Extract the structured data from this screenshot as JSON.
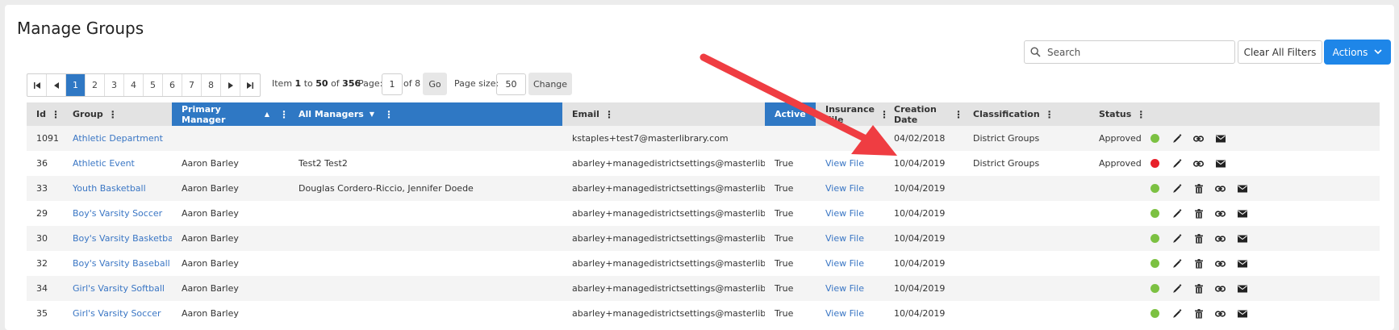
{
  "page": {
    "title": "Manage Groups"
  },
  "toolbar": {
    "search_placeholder": "Search",
    "clear_filters_label": "Clear All Filters",
    "actions_label": "Actions"
  },
  "pager": {
    "pages": [
      "1",
      "2",
      "3",
      "4",
      "5",
      "6",
      "7",
      "8"
    ],
    "active_page": "1",
    "item_prefix": "Item",
    "item_from": "1",
    "item_to_word": "to",
    "item_to": "50",
    "item_of_word": "of",
    "item_total": "356",
    "page_label": "Page:",
    "page_value": "1",
    "of_pages": "of 8",
    "go_label": "Go",
    "page_size_label": "Page size:",
    "page_size_value": "50",
    "change_label": "Change"
  },
  "columns": [
    {
      "key": "id",
      "label": "Id",
      "sort": "",
      "selected": false
    },
    {
      "key": "group",
      "label": "Group",
      "sort": "",
      "selected": false
    },
    {
      "key": "primary_manager",
      "label": "Primary Manager",
      "sort": "▲",
      "selected": true
    },
    {
      "key": "all_managers",
      "label": "All Managers",
      "sort": "▼",
      "selected": true
    },
    {
      "key": "email",
      "label": "Email",
      "sort": "",
      "selected": false
    },
    {
      "key": "active",
      "label": "Active",
      "sort": "",
      "selected": true
    },
    {
      "key": "insurance_file",
      "label": "Insurance File",
      "sort": "",
      "selected": false
    },
    {
      "key": "creation_date",
      "label": "Creation Date",
      "sort": "",
      "selected": false
    },
    {
      "key": "classification",
      "label": "Classification",
      "sort": "",
      "selected": false
    },
    {
      "key": "status",
      "label": "Status",
      "sort": "",
      "selected": false
    }
  ],
  "rows": [
    {
      "id": "1091",
      "group": "Athletic Department",
      "primary_manager": "",
      "all_managers": "",
      "email": "kstaples+test7@masterlibrary.com",
      "active": "",
      "insurance_file": "",
      "creation_date": "04/02/2018",
      "classification": "District Groups",
      "status": "Approved",
      "status_color": "#7cc142",
      "has_delete": false
    },
    {
      "id": "36",
      "group": "Athletic Event",
      "primary_manager": "Aaron Barley",
      "all_managers": "Test2 Test2",
      "email": "abarley+managedistrictsettings@masterlibrary.com",
      "active": "True",
      "insurance_file": "View File",
      "creation_date": "10/04/2019",
      "classification": "District Groups",
      "status": "Approved",
      "status_color": "#e8202a",
      "has_delete": false
    },
    {
      "id": "33",
      "group": "Youth Basketball",
      "primary_manager": "Aaron Barley",
      "all_managers": "Douglas Cordero-Riccio, Jennifer Doede",
      "email": "abarley+managedistrictsettings@masterlibrary.com",
      "active": "True",
      "insurance_file": "View File",
      "creation_date": "10/04/2019",
      "classification": "",
      "status": "",
      "status_color": "#7cc142",
      "has_delete": true
    },
    {
      "id": "29",
      "group": "Boy's Varsity Soccer",
      "primary_manager": "Aaron Barley",
      "all_managers": "",
      "email": "abarley+managedistrictsettings@masterlibrary.com",
      "active": "True",
      "insurance_file": "View File",
      "creation_date": "10/04/2019",
      "classification": "",
      "status": "",
      "status_color": "#7cc142",
      "has_delete": true
    },
    {
      "id": "30",
      "group": "Boy's Varsity Basketball",
      "primary_manager": "Aaron Barley",
      "all_managers": "",
      "email": "abarley+managedistrictsettings@masterlibrary.com",
      "active": "True",
      "insurance_file": "View File",
      "creation_date": "10/04/2019",
      "classification": "",
      "status": "",
      "status_color": "#7cc142",
      "has_delete": true
    },
    {
      "id": "32",
      "group": "Boy's Varsity Baseball",
      "primary_manager": "Aaron Barley",
      "all_managers": "",
      "email": "abarley+managedistrictsettings@masterlibrary.com",
      "active": "True",
      "insurance_file": "View File",
      "creation_date": "10/04/2019",
      "classification": "",
      "status": "",
      "status_color": "#7cc142",
      "has_delete": true
    },
    {
      "id": "34",
      "group": "Girl's Varsity Softball",
      "primary_manager": "Aaron Barley",
      "all_managers": "",
      "email": "abarley+managedistrictsettings@masterlibrary.com",
      "active": "True",
      "insurance_file": "View File",
      "creation_date": "10/04/2019",
      "classification": "",
      "status": "",
      "status_color": "#7cc142",
      "has_delete": true
    },
    {
      "id": "35",
      "group": "Girl's Varsity Soccer",
      "primary_manager": "Aaron Barley",
      "all_managers": "",
      "email": "abarley+managedistrictsettings@masterlibrary.com",
      "active": "True",
      "insurance_file": "View File",
      "creation_date": "10/04/2019",
      "classification": "",
      "status": "",
      "status_color": "#7cc142",
      "has_delete": true
    }
  ],
  "icons": {
    "edit": "pencil-icon",
    "delete": "trash-icon",
    "link": "link-icon",
    "email": "envelope-icon"
  },
  "colors": {
    "accent": "#2f78c4",
    "primary_button": "#1e86e8",
    "link": "#3a76c4",
    "status_ok": "#7cc142",
    "status_bad": "#e8202a",
    "annotation_arrow": "#ef3d42"
  }
}
